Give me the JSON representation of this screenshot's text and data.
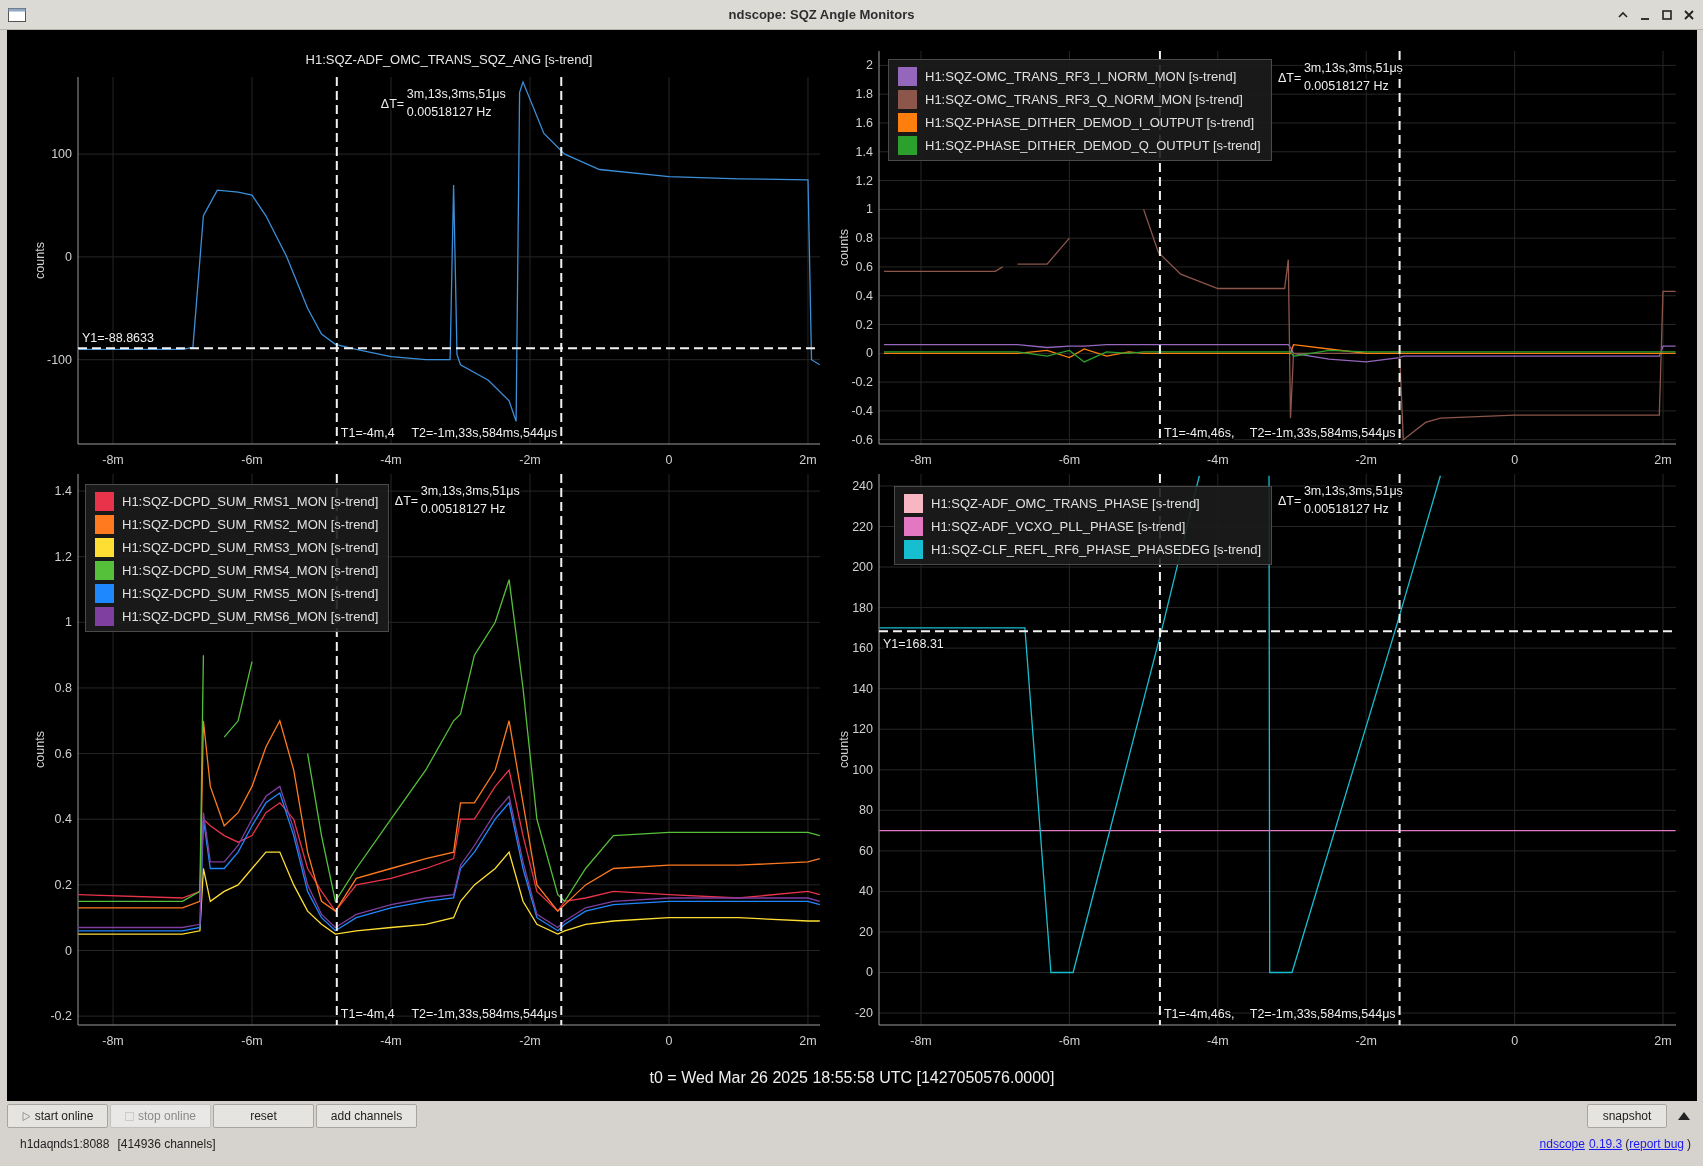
{
  "window": {
    "title": "ndscope: SQZ Angle Monitors"
  },
  "plots": [
    {
      "t_cursors": [
        "T1=-4m,4",
        "T2=-1m,33s,584ms,544μs"
      ],
      "delta": {
        "symbol": "ΔT=",
        "lines": [
          "3m,13s,3ms,51μs",
          "0.00518127 Hz"
        ]
      },
      "y_cursor": "Y1=-88.8633",
      "chart_data": {
        "type": "line",
        "title": "H1:SQZ-ADF_OMC_TRANS_SQZ_ANG [s-trend]",
        "ylabel": "counts",
        "grid": true,
        "ref_lines": [
          {
            "axis": "x",
            "value": -4.78
          },
          {
            "axis": "x",
            "value": -1.55
          },
          {
            "axis": "y",
            "value": -88.8633
          }
        ],
        "xlim": [
          -8.504,
          2.173
        ],
        "ylim": [
          -182,
          175
        ],
        "xticks": [
          {
            "value": -8,
            "label": "-8m"
          },
          {
            "value": -6,
            "label": "-6m"
          },
          {
            "value": -4,
            "label": "-4m"
          },
          {
            "value": -2,
            "label": "-2m"
          },
          {
            "value": 0,
            "label": "0"
          },
          {
            "value": 2,
            "label": "2m"
          }
        ],
        "yticks": [
          -100,
          0,
          100
        ],
        "x": [
          -8.5,
          -7,
          -6.85,
          -6.7,
          -6.5,
          -6.2,
          -6,
          -5.8,
          -5.5,
          -5.2,
          -5,
          -4.8,
          -4.5,
          -4,
          -3.5,
          -3.15,
          -3.1,
          -3.05,
          -3.0,
          -2.6,
          -2.3,
          -2.2,
          -2.15,
          -2.1,
          -1.8,
          -1.5,
          -1,
          0,
          1,
          2,
          2.05,
          2.17
        ],
        "series": [
          {
            "color": "#3b8ed8",
            "values": [
              -90,
              -90,
              -88,
              40,
              65,
              63,
              60,
              40,
              0,
              -50,
              -75,
              -85,
              -90,
              -97,
              -100,
              -100,
              70,
              -95,
              -105,
              -120,
              -140,
              -160,
              160,
              170,
              120,
              100,
              85,
              78,
              76,
              75,
              -100,
              -105
            ]
          }
        ]
      }
    },
    {
      "t_cursors": [
        "T1=-4m,46s,",
        "T2=-1m,33s,584ms,544μs"
      ],
      "delta": {
        "symbol": "ΔT=",
        "lines": [
          "3m,13s,3ms,51μs",
          "0.00518127 Hz"
        ]
      },
      "chart_data": {
        "type": "line",
        "ylabel": "counts",
        "grid": true,
        "ref_lines": [
          {
            "axis": "x",
            "value": -4.78
          },
          {
            "axis": "x",
            "value": -1.55
          }
        ],
        "xlim": [
          -8.566,
          2.175
        ],
        "ylim": [
          -0.63,
          2.1
        ],
        "xticks": [
          {
            "value": -8,
            "label": "-8m"
          },
          {
            "value": -6,
            "label": "-6m"
          },
          {
            "value": -4,
            "label": "-4m"
          },
          {
            "value": -2,
            "label": "-2m"
          },
          {
            "value": 0,
            "label": "0"
          },
          {
            "value": 2,
            "label": "2m"
          }
        ],
        "yticks": [
          -0.6,
          -0.4,
          -0.2,
          0,
          0.2,
          0.4,
          0.6,
          0.8,
          1,
          1.2,
          1.4,
          1.6,
          1.8,
          2
        ],
        "x": [
          -8.5,
          -7,
          -6.9,
          -6.8,
          -6.7,
          -6.3,
          -6,
          -5.8,
          -5.5,
          -5.2,
          -5,
          -4.8,
          -4.5,
          -4,
          -3.1,
          -3.05,
          -3.02,
          -2.98,
          -2.5,
          -2,
          -1.55,
          -1.5,
          -1.2,
          -1,
          0,
          1,
          1.95,
          2,
          2.17
        ],
        "series": [
          {
            "name": "H1:SQZ-OMC_TRANS_RF3_I_NORM_MON [s-trend]",
            "color": "#9467bd",
            "values": [
              0.06,
              0.06,
              0.06,
              0.06,
              0.06,
              0.04,
              0.05,
              0.05,
              0.06,
              0.06,
              0.06,
              0.06,
              0.06,
              0.06,
              0.06,
              0.06,
              0.04,
              0.0,
              -0.04,
              -0.06,
              -0.03,
              -0.02,
              -0.02,
              -0.02,
              -0.02,
              -0.02,
              -0.02,
              0.05,
              0.05
            ]
          },
          {
            "name": "H1:SQZ-OMC_TRANS_RF3_Q_NORM_MON [s-trend]",
            "color": "#8c564b",
            "values": [
              0.57,
              0.57,
              0.6,
              null,
              0.62,
              0.62,
              0.8,
              null,
              null,
              null,
              1.0,
              0.7,
              0.55,
              0.45,
              0.45,
              0.65,
              -0.45,
              0,
              0,
              0,
              0,
              -0.6,
              -0.48,
              -0.45,
              -0.43,
              -0.43,
              -0.43,
              0.43,
              0.43
            ]
          },
          {
            "name": "H1:SQZ-PHASE_DITHER_DEMOD_I_OUTPUT [s-trend]",
            "color": "#ff7f0e",
            "values": [
              0,
              0,
              0,
              0,
              0,
              0.02,
              -0.03,
              0.03,
              -0.02,
              0.01,
              0,
              0,
              0,
              0,
              0,
              0,
              0,
              0.06,
              0.03,
              0,
              0,
              0,
              0,
              0,
              0,
              0,
              0,
              0,
              0
            ]
          },
          {
            "name": "H1:SQZ-PHASE_DITHER_DEMOD_Q_OUTPUT [s-trend]",
            "color": "#2ca02c",
            "values": [
              0.01,
              0.01,
              0.01,
              0.01,
              0.01,
              -0.02,
              0.02,
              -0.06,
              0.01,
              0,
              0.01,
              0.01,
              0.01,
              0.01,
              0.01,
              0.01,
              0.01,
              -0.02,
              0.02,
              0.01,
              0.01,
              0.01,
              0.01,
              0.01,
              0.01,
              0.01,
              0.01,
              0.01,
              0.01
            ]
          }
        ]
      }
    },
    {
      "t_cursors": [
        "T1=-4m,4",
        "T2=-1m,33s,584ms,544μs"
      ],
      "delta": {
        "symbol": "ΔT=",
        "lines": [
          "3m,13s,3ms,51μs",
          "0.00518127 Hz"
        ]
      },
      "chart_data": {
        "type": "line",
        "ylabel": "counts",
        "grid": true,
        "ref_lines": [
          {
            "axis": "x",
            "value": -4.78
          },
          {
            "axis": "x",
            "value": -1.55
          }
        ],
        "xlim": [
          -8.504,
          2.173
        ],
        "ylim": [
          -0.227,
          1.452
        ],
        "xticks": [
          {
            "value": -8,
            "label": "-8m"
          },
          {
            "value": -6,
            "label": "-6m"
          },
          {
            "value": -4,
            "label": "-4m"
          },
          {
            "value": -2,
            "label": "-2m"
          },
          {
            "value": 0,
            "label": "0"
          },
          {
            "value": 2,
            "label": "2m"
          }
        ],
        "yticks": [
          -0.2,
          0,
          0.2,
          0.4,
          0.6,
          0.8,
          1,
          1.2,
          1.4
        ],
        "x": [
          -8.5,
          -7,
          -6.75,
          -6.7,
          -6.6,
          -6.4,
          -6.2,
          -6,
          -5.8,
          -5.6,
          -5.4,
          -5.2,
          -5,
          -4.8,
          -4.5,
          -4,
          -3.5,
          -3.1,
          -3,
          -2.8,
          -2.5,
          -2.3,
          -2.1,
          -1.9,
          -1.6,
          -1.5,
          -1.2,
          -0.8,
          0,
          1,
          2,
          2.17
        ],
        "series": [
          {
            "name": "H1:SQZ-DCPD_SUM_RMS1_MON [s-trend]",
            "color": "#e8334a",
            "values": [
              0.17,
              0.16,
              0.18,
              0.4,
              0.38,
              0.35,
              0.33,
              0.35,
              0.42,
              0.45,
              0.4,
              0.25,
              0.18,
              0.12,
              0.2,
              0.22,
              0.25,
              0.28,
              0.4,
              0.4,
              0.5,
              0.55,
              0.35,
              0.18,
              0.12,
              0.15,
              0.16,
              0.18,
              0.17,
              0.16,
              0.18,
              0.17
            ]
          },
          {
            "name": "H1:SQZ-DCPD_SUM_RMS2_MON [s-trend]",
            "color": "#ff7a1f",
            "values": [
              0.13,
              0.13,
              0.15,
              0.7,
              0.5,
              0.38,
              0.42,
              0.5,
              0.62,
              0.7,
              0.55,
              0.3,
              0.15,
              0.12,
              0.22,
              0.25,
              0.28,
              0.3,
              0.45,
              0.45,
              0.55,
              0.7,
              0.45,
              0.2,
              0.12,
              0.14,
              0.2,
              0.25,
              0.26,
              0.26,
              0.27,
              0.28
            ]
          },
          {
            "name": "H1:SQZ-DCPD_SUM_RMS3_MON [s-trend]",
            "color": "#ffde33",
            "values": [
              0.05,
              0.05,
              0.06,
              0.25,
              0.15,
              0.18,
              0.2,
              0.25,
              0.3,
              0.3,
              0.2,
              0.12,
              0.08,
              0.05,
              0.06,
              0.07,
              0.08,
              0.1,
              0.15,
              0.2,
              0.25,
              0.3,
              0.15,
              0.08,
              0.05,
              0.06,
              0.08,
              0.09,
              0.1,
              0.1,
              0.09,
              0.09
            ]
          },
          {
            "name": "H1:SQZ-DCPD_SUM_RMS4_MON [s-trend]",
            "color": "#55c03a",
            "values": [
              0.15,
              0.15,
              0.18,
              0.9,
              null,
              0.65,
              0.7,
              0.88,
              null,
              null,
              null,
              0.6,
              0.35,
              0.15,
              0.25,
              0.4,
              0.55,
              0.7,
              0.72,
              0.9,
              1.0,
              1.13,
              0.8,
              0.4,
              0.17,
              0.15,
              0.25,
              0.35,
              0.36,
              0.36,
              0.36,
              0.35
            ]
          },
          {
            "name": "H1:SQZ-DCPD_SUM_RMS5_MON [s-trend]",
            "color": "#1e88ff",
            "values": [
              0.06,
              0.06,
              0.07,
              0.4,
              0.25,
              0.25,
              0.3,
              0.38,
              0.45,
              0.48,
              0.35,
              0.18,
              0.1,
              0.06,
              0.1,
              0.13,
              0.15,
              0.16,
              0.25,
              0.3,
              0.4,
              0.45,
              0.25,
              0.1,
              0.06,
              0.08,
              0.12,
              0.14,
              0.15,
              0.15,
              0.15,
              0.14
            ]
          },
          {
            "name": "H1:SQZ-DCPD_SUM_RMS6_MON [s-trend]",
            "color": "#7e3fa0",
            "values": [
              0.07,
              0.07,
              0.08,
              0.42,
              0.27,
              0.27,
              0.32,
              0.4,
              0.47,
              0.5,
              0.37,
              0.2,
              0.11,
              0.07,
              0.11,
              0.14,
              0.16,
              0.17,
              0.26,
              0.32,
              0.42,
              0.47,
              0.27,
              0.11,
              0.07,
              0.09,
              0.13,
              0.15,
              0.16,
              0.16,
              0.16,
              0.15
            ]
          }
        ]
      }
    },
    {
      "t_cursors": [
        "T1=-4m,46s,",
        "T2=-1m,33s,584ms,544μs"
      ],
      "delta": {
        "symbol": "ΔT=",
        "lines": [
          "3m,13s,3ms,51μs",
          "0.00518127 Hz"
        ]
      },
      "y_cursor": "Y1=168.31",
      "chart_data": {
        "type": "line",
        "ylabel": "counts",
        "grid": true,
        "ref_lines": [
          {
            "axis": "x",
            "value": -4.78
          },
          {
            "axis": "x",
            "value": -1.55
          },
          {
            "axis": "y",
            "value": 168.31
          }
        ],
        "xlim": [
          -8.566,
          2.175
        ],
        "ylim": [
          -25.9,
          245.9
        ],
        "xticks": [
          {
            "value": -8,
            "label": "-8m"
          },
          {
            "value": -6,
            "label": "-6m"
          },
          {
            "value": -4,
            "label": "-4m"
          },
          {
            "value": -2,
            "label": "-2m"
          },
          {
            "value": 0,
            "label": "0"
          },
          {
            "value": 2,
            "label": "2m"
          }
        ],
        "yticks": [
          -20,
          0,
          20,
          40,
          60,
          80,
          100,
          120,
          140,
          160,
          180,
          200,
          220,
          240
        ],
        "x": [
          -8.56,
          -6.6,
          -6.25,
          -5.95,
          -4.75,
          -4.25,
          -3.8,
          -3.31,
          -3.3,
          -3.0,
          -1.6,
          -1.0,
          2.17
        ],
        "series": [
          {
            "name": "H1:SQZ-ADF_OMC_TRANS_PHASE [s-trend]",
            "color": "#f7b6c2",
            "values": [
              null,
              null,
              null,
              null,
              null,
              null,
              null,
              null,
              null,
              null,
              null,
              null,
              null
            ]
          },
          {
            "name": "H1:SQZ-ADF_VCXO_PLL_PHASE [s-trend]",
            "color": "#e377c2",
            "values": [
              70,
              70,
              70,
              70,
              70,
              70,
              70,
              70,
              70,
              70,
              70,
              70,
              70
            ]
          },
          {
            "name": "H1:SQZ-CLF_REFL_RF6_PHASE_PHASEDEG [s-trend]",
            "color": "#17becf",
            "values": [
              170,
              170,
              0,
              0,
              170,
              245,
              null,
              245,
              0,
              0,
              170,
              245,
              null
            ]
          }
        ]
      }
    }
  ],
  "t0": "t0 = Wed Mar 26 2025 18:55:58 UTC [1427050576.0000]",
  "toolbar": {
    "buttons": [
      {
        "label": "start online",
        "kind": "play",
        "disabled": false
      },
      {
        "label": "stop online",
        "kind": "stop",
        "disabled": true
      },
      {
        "label": "reset",
        "kind": "plain",
        "disabled": false
      },
      {
        "label": "add channels",
        "kind": "plain",
        "disabled": false
      }
    ],
    "snapshot": "snapshot"
  },
  "status": {
    "server": "h1daqnds1:8088",
    "channels": "[414936 channels]",
    "version_line": [
      {
        "text": "ndscope",
        "kind": "link"
      },
      {
        "text": "0.19.3",
        "kind": "link"
      },
      {
        "text": "(",
        "kind": "text"
      },
      {
        "text": "report bug",
        "kind": "link"
      },
      {
        "text": ")",
        "kind": "text"
      }
    ]
  }
}
